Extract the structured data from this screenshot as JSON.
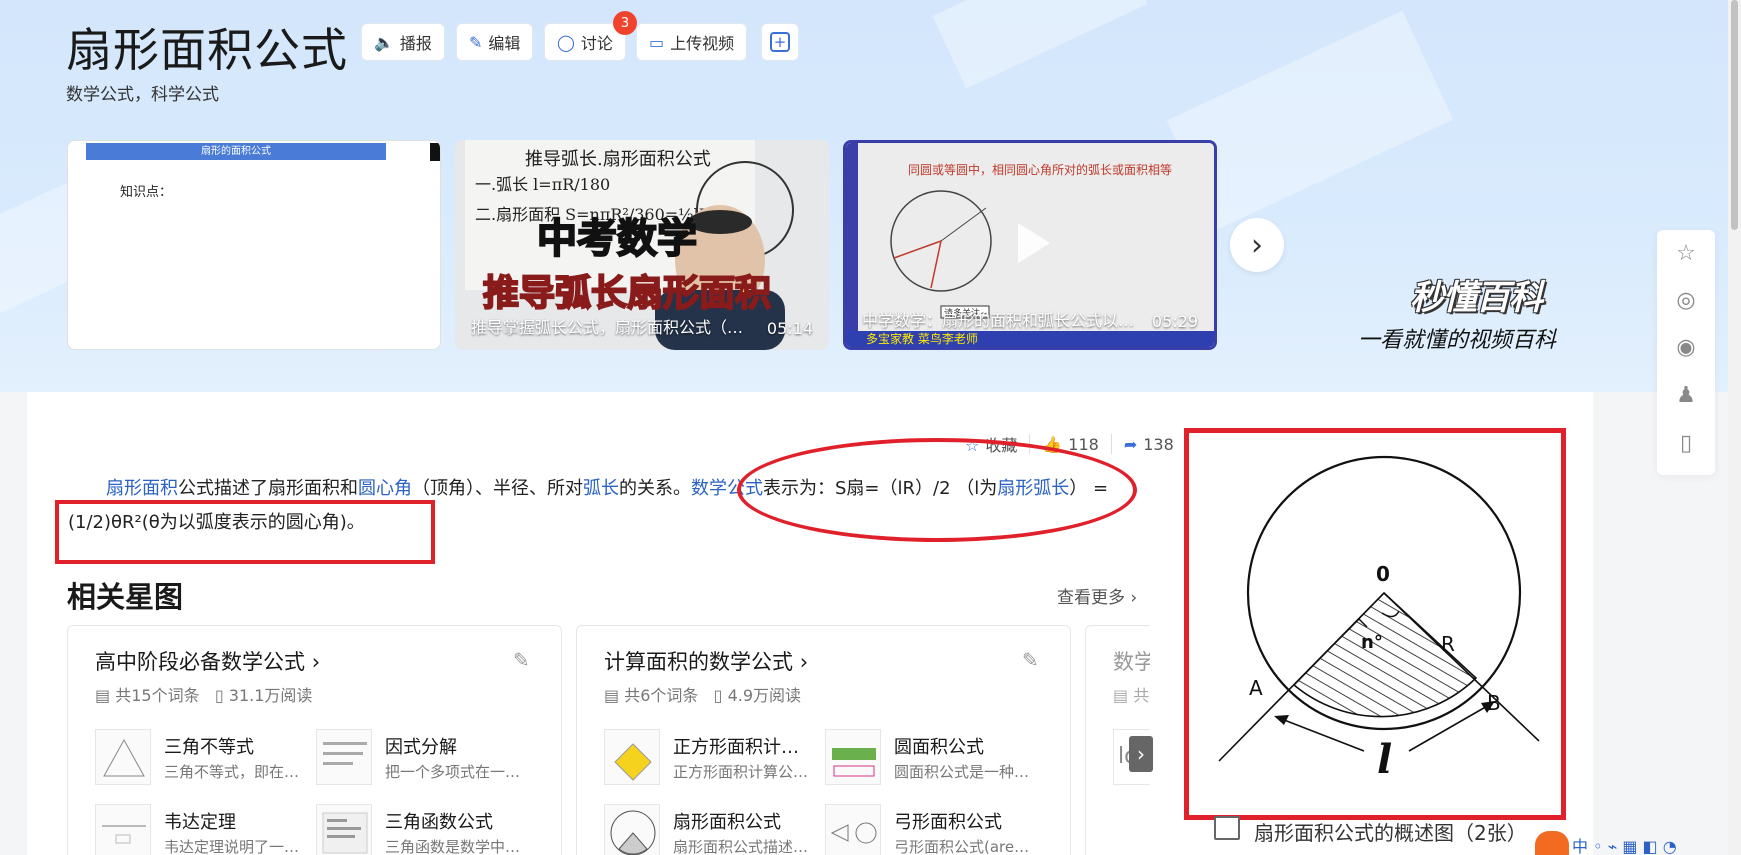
{
  "page": {
    "title": "扇形面积公式",
    "subtitle": "数学公式，科学公式"
  },
  "title_buttons": {
    "broadcast": "播报",
    "edit": "编辑",
    "discuss": "讨论",
    "discuss_badge": "3",
    "upload_video": "上传视频",
    "add": "+"
  },
  "videos": [
    {
      "slide_header": "扇形的面积公式",
      "slide_text": "知识点：",
      "caption": "",
      "duration": ""
    },
    {
      "caption": "推导掌握弧长公式，扇形面积公式（…",
      "duration": "05:14",
      "overlay_top": "中考数学",
      "overlay_bottom": "推导弧长扇形面积",
      "board_text": "推导弧长.扇形面积公式"
    },
    {
      "caption": "中学数学：扇形的面积和弧长公式以…",
      "duration": "05:29",
      "slide_heading": "同圆或等圆中，相同圆心角所对的弧长或面积相等",
      "subscribe": "请多关注~",
      "author": "多宝家教 菜鸟李老师"
    }
  ],
  "brand": {
    "logo": "秒懂百科",
    "slogan": "一看就懂的视频百科"
  },
  "sidebar_icons": [
    "star-plus-icon",
    "weibo-icon",
    "wechat-icon",
    "qq-icon",
    "mobile-icon"
  ],
  "actions": {
    "favorite": "收藏",
    "likes": "118",
    "shares": "138"
  },
  "description": {
    "p1_link1": "扇形面积",
    "p1_t1": "公式描述了扇形面积和",
    "p1_link2": "圆心角",
    "p1_t2": "（顶角）、半径、所对",
    "p1_link3": "弧长",
    "p1_t3": "的关系。",
    "p1_link4": "数学公式",
    "p1_t4": "表示为：S扇=（lR）/2 （l为",
    "p1_link5": "扇形弧长",
    "p1_t5": "） =(1/2)θR²(θ为以弧度表示的圆心角)。"
  },
  "related": {
    "title": "相关星图",
    "see_more": "查看更多",
    "cards": [
      {
        "title": "高中阶段必备数学公式",
        "count": "共15个词条",
        "reads": "31.1万阅读",
        "entries": [
          {
            "title": "三角不等式",
            "desc": "三角不等式，即在…"
          },
          {
            "title": "因式分解",
            "desc": "把一个多项式在一…"
          },
          {
            "title": "韦达定理",
            "desc": "韦达定理说明了一…"
          },
          {
            "title": "三角函数公式",
            "desc": "三角函数是数学中…"
          }
        ]
      },
      {
        "title": "计算面积的数学公式",
        "count": "共6个词条",
        "reads": "4.9万阅读",
        "entries": [
          {
            "title": "正方形面积计…",
            "desc": "正方形面积计算公…"
          },
          {
            "title": "圆面积公式",
            "desc": "圆面积公式是一种…"
          },
          {
            "title": "扇形面积公式",
            "desc": "扇形面积公式描述…"
          },
          {
            "title": "弓形面积公式",
            "desc": "弓形面积公式(are…"
          }
        ]
      },
      {
        "title": "数学",
        "count": "共"
      }
    ]
  },
  "figure": {
    "caption": "扇形面积公式的概述图（2张）",
    "labels": {
      "o": "0",
      "n": "n°",
      "r": "R",
      "a": "A",
      "b": "B",
      "l": "l"
    }
  },
  "colors": {
    "link": "#2b62c4",
    "annotation_red": "#e0202a",
    "badge": "#f0432d"
  }
}
